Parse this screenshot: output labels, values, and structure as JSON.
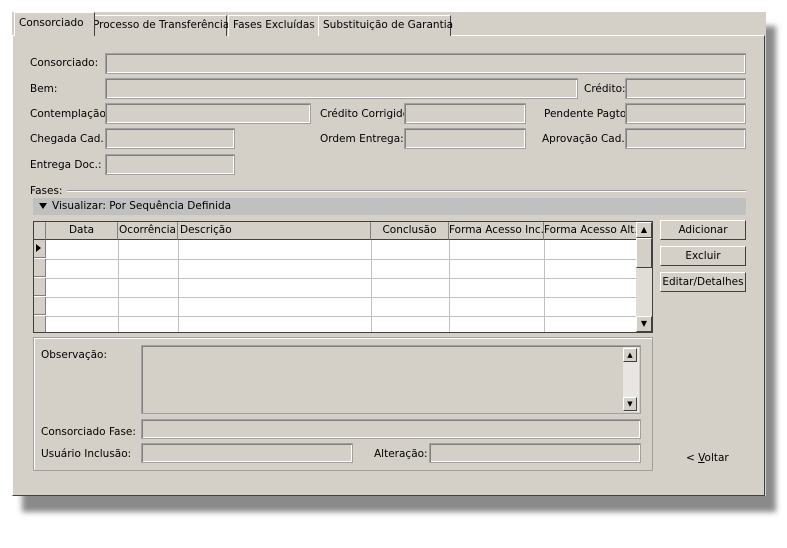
{
  "tabs": [
    "Consorciado",
    "Processo de Transferência",
    "Fases Excluídas",
    "Substituição de Garantia"
  ],
  "labels": {
    "consorciado": "Consorciado:",
    "bem": "Bem:",
    "credito": "Crédito:",
    "contemplacao": "Contemplação:",
    "credito_corrigido": "Crédito Corrigido:",
    "pendente_pagto": "Pendente Pagto:",
    "chegada_cad": "Chegada Cad.:",
    "ordem_entrega": "Ordem Entrega:",
    "aprovacao_cad": "Aprovação Cad.:",
    "entrega_doc": "Entrega Doc.:"
  },
  "fases": {
    "title": "Fases:",
    "view_label": "Visualizar: Por Sequência Definida",
    "columns": [
      "Data",
      "Ocorrência",
      "Descrição",
      "Conclusão",
      "Forma Acesso Inc.",
      "Forma Acesso Alt."
    ],
    "row_count": 5
  },
  "buttons": {
    "adicionar": "Adicionar",
    "excluir": "Excluir",
    "editar": "Editar/Detalhes"
  },
  "detail": {
    "observacao": "Observação:",
    "consorciado_fase": "Consorciado Fase:",
    "usuario_inclusao": "Usuário Inclusão:",
    "alteracao": "Alteração:"
  },
  "voltar": {
    "prefix": "< ",
    "accel": "V",
    "rest": "oltar"
  }
}
